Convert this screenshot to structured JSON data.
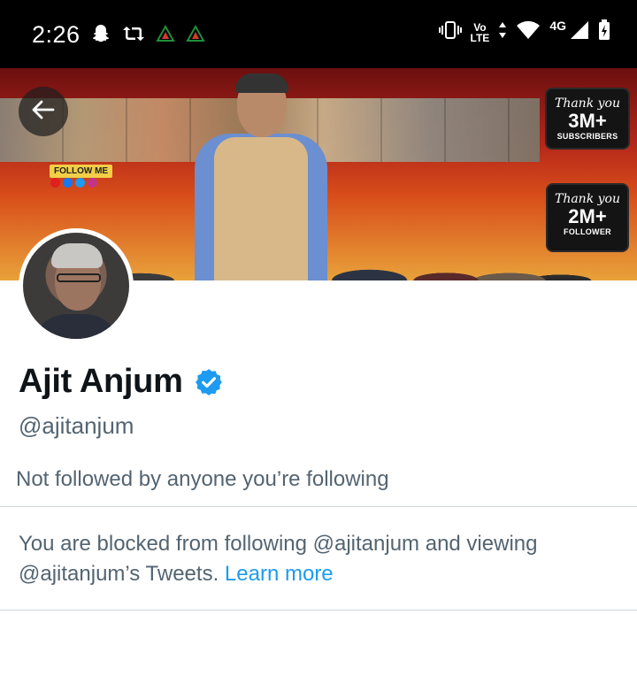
{
  "status_bar": {
    "time": "2:26",
    "network_small": "Vo",
    "network_lte": "LTE",
    "network_type": "4G"
  },
  "banner": {
    "follow_me": "FOLLOW ME",
    "youtube_badge": {
      "thank": "Thank you",
      "count": "3M+",
      "label": "SUBSCRIBERS"
    },
    "facebook_badge": {
      "thank": "Thank you",
      "count": "2M+",
      "label": "FOLLOWER"
    }
  },
  "profile": {
    "display_name": "Ajit Anjum",
    "handle": "@ajitanjum",
    "followers_note": "Not followed by anyone you’re following",
    "blocked_text": "You are blocked from following @ajitanjum and viewing @ajitanjum’s Tweets.",
    "learn_more": "Learn more"
  },
  "colors": {
    "accent": "#1d9bf0",
    "secondary_text": "#536471",
    "primary_text": "#0f1419",
    "divider": "#cfd9de"
  },
  "icons": {
    "back": "arrow-left-icon",
    "verified": "verified-badge-icon",
    "snapchat": "snapchat-icon",
    "retweet": "retweet-icon",
    "vibrate": "vibrate-icon",
    "wifi": "wifi-icon",
    "signal": "signal-icon",
    "battery": "battery-charging-icon"
  }
}
